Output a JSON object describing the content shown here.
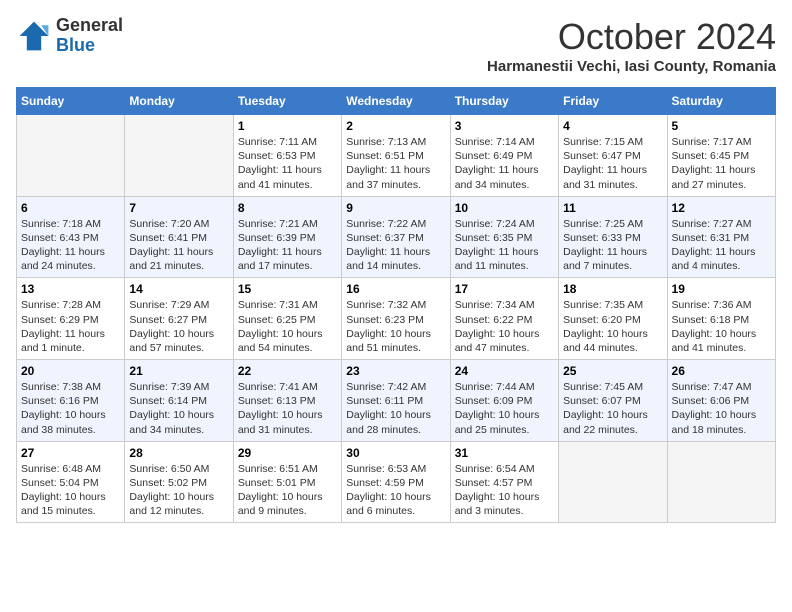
{
  "header": {
    "logo_general": "General",
    "logo_blue": "Blue",
    "month": "October 2024",
    "location": "Harmanestii Vechi, Iasi County, Romania"
  },
  "days_of_week": [
    "Sunday",
    "Monday",
    "Tuesday",
    "Wednesday",
    "Thursday",
    "Friday",
    "Saturday"
  ],
  "weeks": [
    [
      {
        "day": "",
        "sunrise": "",
        "sunset": "",
        "daylight": "",
        "empty": true
      },
      {
        "day": "",
        "sunrise": "",
        "sunset": "",
        "daylight": "",
        "empty": true
      },
      {
        "day": "1",
        "sunrise": "Sunrise: 7:11 AM",
        "sunset": "Sunset: 6:53 PM",
        "daylight": "Daylight: 11 hours and 41 minutes.",
        "empty": false
      },
      {
        "day": "2",
        "sunrise": "Sunrise: 7:13 AM",
        "sunset": "Sunset: 6:51 PM",
        "daylight": "Daylight: 11 hours and 37 minutes.",
        "empty": false
      },
      {
        "day": "3",
        "sunrise": "Sunrise: 7:14 AM",
        "sunset": "Sunset: 6:49 PM",
        "daylight": "Daylight: 11 hours and 34 minutes.",
        "empty": false
      },
      {
        "day": "4",
        "sunrise": "Sunrise: 7:15 AM",
        "sunset": "Sunset: 6:47 PM",
        "daylight": "Daylight: 11 hours and 31 minutes.",
        "empty": false
      },
      {
        "day": "5",
        "sunrise": "Sunrise: 7:17 AM",
        "sunset": "Sunset: 6:45 PM",
        "daylight": "Daylight: 11 hours and 27 minutes.",
        "empty": false
      }
    ],
    [
      {
        "day": "6",
        "sunrise": "Sunrise: 7:18 AM",
        "sunset": "Sunset: 6:43 PM",
        "daylight": "Daylight: 11 hours and 24 minutes.",
        "empty": false
      },
      {
        "day": "7",
        "sunrise": "Sunrise: 7:20 AM",
        "sunset": "Sunset: 6:41 PM",
        "daylight": "Daylight: 11 hours and 21 minutes.",
        "empty": false
      },
      {
        "day": "8",
        "sunrise": "Sunrise: 7:21 AM",
        "sunset": "Sunset: 6:39 PM",
        "daylight": "Daylight: 11 hours and 17 minutes.",
        "empty": false
      },
      {
        "day": "9",
        "sunrise": "Sunrise: 7:22 AM",
        "sunset": "Sunset: 6:37 PM",
        "daylight": "Daylight: 11 hours and 14 minutes.",
        "empty": false
      },
      {
        "day": "10",
        "sunrise": "Sunrise: 7:24 AM",
        "sunset": "Sunset: 6:35 PM",
        "daylight": "Daylight: 11 hours and 11 minutes.",
        "empty": false
      },
      {
        "day": "11",
        "sunrise": "Sunrise: 7:25 AM",
        "sunset": "Sunset: 6:33 PM",
        "daylight": "Daylight: 11 hours and 7 minutes.",
        "empty": false
      },
      {
        "day": "12",
        "sunrise": "Sunrise: 7:27 AM",
        "sunset": "Sunset: 6:31 PM",
        "daylight": "Daylight: 11 hours and 4 minutes.",
        "empty": false
      }
    ],
    [
      {
        "day": "13",
        "sunrise": "Sunrise: 7:28 AM",
        "sunset": "Sunset: 6:29 PM",
        "daylight": "Daylight: 11 hours and 1 minute.",
        "empty": false
      },
      {
        "day": "14",
        "sunrise": "Sunrise: 7:29 AM",
        "sunset": "Sunset: 6:27 PM",
        "daylight": "Daylight: 10 hours and 57 minutes.",
        "empty": false
      },
      {
        "day": "15",
        "sunrise": "Sunrise: 7:31 AM",
        "sunset": "Sunset: 6:25 PM",
        "daylight": "Daylight: 10 hours and 54 minutes.",
        "empty": false
      },
      {
        "day": "16",
        "sunrise": "Sunrise: 7:32 AM",
        "sunset": "Sunset: 6:23 PM",
        "daylight": "Daylight: 10 hours and 51 minutes.",
        "empty": false
      },
      {
        "day": "17",
        "sunrise": "Sunrise: 7:34 AM",
        "sunset": "Sunset: 6:22 PM",
        "daylight": "Daylight: 10 hours and 47 minutes.",
        "empty": false
      },
      {
        "day": "18",
        "sunrise": "Sunrise: 7:35 AM",
        "sunset": "Sunset: 6:20 PM",
        "daylight": "Daylight: 10 hours and 44 minutes.",
        "empty": false
      },
      {
        "day": "19",
        "sunrise": "Sunrise: 7:36 AM",
        "sunset": "Sunset: 6:18 PM",
        "daylight": "Daylight: 10 hours and 41 minutes.",
        "empty": false
      }
    ],
    [
      {
        "day": "20",
        "sunrise": "Sunrise: 7:38 AM",
        "sunset": "Sunset: 6:16 PM",
        "daylight": "Daylight: 10 hours and 38 minutes.",
        "empty": false
      },
      {
        "day": "21",
        "sunrise": "Sunrise: 7:39 AM",
        "sunset": "Sunset: 6:14 PM",
        "daylight": "Daylight: 10 hours and 34 minutes.",
        "empty": false
      },
      {
        "day": "22",
        "sunrise": "Sunrise: 7:41 AM",
        "sunset": "Sunset: 6:13 PM",
        "daylight": "Daylight: 10 hours and 31 minutes.",
        "empty": false
      },
      {
        "day": "23",
        "sunrise": "Sunrise: 7:42 AM",
        "sunset": "Sunset: 6:11 PM",
        "daylight": "Daylight: 10 hours and 28 minutes.",
        "empty": false
      },
      {
        "day": "24",
        "sunrise": "Sunrise: 7:44 AM",
        "sunset": "Sunset: 6:09 PM",
        "daylight": "Daylight: 10 hours and 25 minutes.",
        "empty": false
      },
      {
        "day": "25",
        "sunrise": "Sunrise: 7:45 AM",
        "sunset": "Sunset: 6:07 PM",
        "daylight": "Daylight: 10 hours and 22 minutes.",
        "empty": false
      },
      {
        "day": "26",
        "sunrise": "Sunrise: 7:47 AM",
        "sunset": "Sunset: 6:06 PM",
        "daylight": "Daylight: 10 hours and 18 minutes.",
        "empty": false
      }
    ],
    [
      {
        "day": "27",
        "sunrise": "Sunrise: 6:48 AM",
        "sunset": "Sunset: 5:04 PM",
        "daylight": "Daylight: 10 hours and 15 minutes.",
        "empty": false
      },
      {
        "day": "28",
        "sunrise": "Sunrise: 6:50 AM",
        "sunset": "Sunset: 5:02 PM",
        "daylight": "Daylight: 10 hours and 12 minutes.",
        "empty": false
      },
      {
        "day": "29",
        "sunrise": "Sunrise: 6:51 AM",
        "sunset": "Sunset: 5:01 PM",
        "daylight": "Daylight: 10 hours and 9 minutes.",
        "empty": false
      },
      {
        "day": "30",
        "sunrise": "Sunrise: 6:53 AM",
        "sunset": "Sunset: 4:59 PM",
        "daylight": "Daylight: 10 hours and 6 minutes.",
        "empty": false
      },
      {
        "day": "31",
        "sunrise": "Sunrise: 6:54 AM",
        "sunset": "Sunset: 4:57 PM",
        "daylight": "Daylight: 10 hours and 3 minutes.",
        "empty": false
      },
      {
        "day": "",
        "sunrise": "",
        "sunset": "",
        "daylight": "",
        "empty": true
      },
      {
        "day": "",
        "sunrise": "",
        "sunset": "",
        "daylight": "",
        "empty": true
      }
    ]
  ]
}
